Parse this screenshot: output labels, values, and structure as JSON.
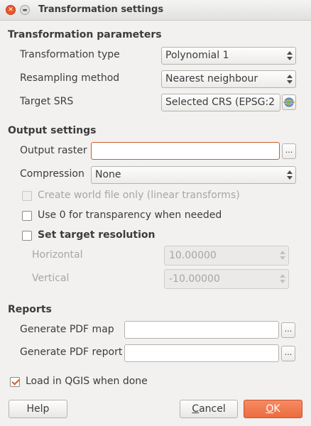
{
  "window": {
    "title": "Transformation settings"
  },
  "params": {
    "heading": "Transformation parameters",
    "transformation_type": {
      "label": "Transformation type",
      "value": "Polynomial 1"
    },
    "resampling": {
      "label": "Resampling method",
      "value": "Nearest neighbour"
    },
    "target_srs": {
      "label": "Target SRS",
      "value": "Selected CRS (EPSG:2"
    }
  },
  "output": {
    "heading": "Output settings",
    "raster_label": "Output raster",
    "raster_value": "",
    "browse": "...",
    "compression": {
      "label": "Compression",
      "value": "None"
    },
    "world_file": {
      "label": "Create world file only (linear transforms)",
      "checked": false,
      "enabled": false
    },
    "transparency": {
      "label": "Use 0 for transparency when needed",
      "checked": false
    },
    "resolution": {
      "label": "Set target resolution",
      "checked": false
    },
    "horizontal": {
      "label": "Horizontal",
      "value": "10.00000"
    },
    "vertical": {
      "label": "Vertical",
      "value": "-10.00000"
    }
  },
  "reports": {
    "heading": "Reports",
    "pdf_map_label": "Generate PDF map",
    "pdf_map_value": "",
    "pdf_report_label": "Generate PDF report",
    "pdf_report_value": "",
    "browse": "..."
  },
  "load_qgis": {
    "label": "Load in QGIS when done",
    "checked": true
  },
  "buttons": {
    "help": "Help",
    "cancel": "Cancel",
    "ok": "OK"
  },
  "colors": {
    "accent": "#ec6b3e",
    "focus_border": "#d35b2b",
    "window_bg": "#f2f1f0"
  },
  "icons": {
    "close": "close-icon",
    "minimize": "minimize-icon",
    "crs": "globe-icon"
  }
}
